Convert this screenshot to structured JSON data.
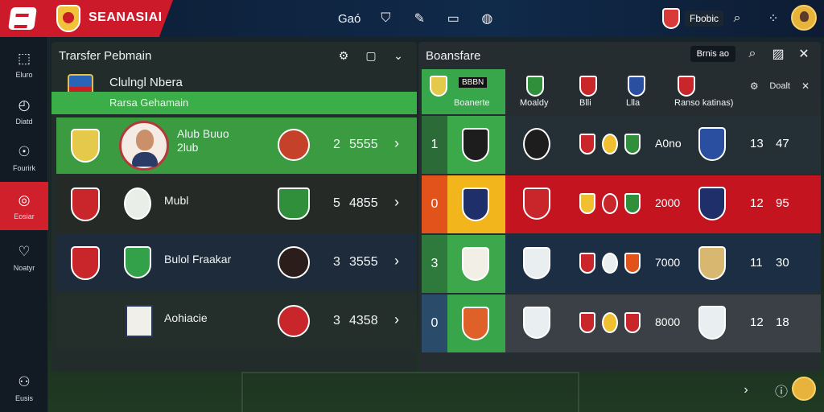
{
  "topbar": {
    "brand": "SEANASIAI",
    "tool_label": "Gaó",
    "user_name": "Fbobic"
  },
  "nav": [
    {
      "label": "Eluro",
      "icon": "transfer-icon"
    },
    {
      "label": "Diatd",
      "icon": "clock-icon"
    },
    {
      "label": "Fourirk",
      "icon": "runner-icon"
    },
    {
      "label": "Eosiar",
      "icon": "target-icon"
    },
    {
      "label": "Noatyr",
      "icon": "heart-icon"
    },
    {
      "label": "Eusis",
      "icon": "trophy-icon"
    }
  ],
  "left_panel": {
    "title": "Trarsfer Pebmain",
    "club_name": "Clulngl Nbera",
    "club_sub": "Rarsa Gehamain",
    "rows": [
      {
        "name_line1": "Alub Buuo",
        "name_line2": "2lub",
        "n1": "2",
        "n2": "5555",
        "bg": "#3a9b41"
      },
      {
        "name": "Mubl",
        "n1": "5",
        "n2": "4855",
        "bg": "#262a27"
      },
      {
        "name": "Bulol Fraakar",
        "n1": "3",
        "n2": "3555",
        "bg": "#1d2b3a"
      },
      {
        "name": "Aohiacie",
        "n1": "3",
        "n2": "4358",
        "bg": "#242e2a"
      }
    ]
  },
  "right_panel": {
    "title": "Boansfare",
    "pill": "Brnis ao",
    "first_col_tag": "BBBN",
    "col_labels": [
      "Boanerte",
      "Moaldy",
      "Blli",
      "Llla",
      "Ranso katinas)"
    ],
    "right_label": "Doalt",
    "rows": [
      {
        "rank": "1",
        "value": "A0no",
        "a": "13",
        "b": "47",
        "rank_bg": "#2a6b38",
        "mid_bg": "#3ba84a",
        "bg": "#253036"
      },
      {
        "rank": "0",
        "value": "2000",
        "a": "12",
        "b": "95",
        "rank_bg": "#e2531c",
        "mid_bg": "#f2b51c",
        "bg": "#c3141f"
      },
      {
        "rank": "3",
        "value": "7000",
        "a": "11",
        "b": "30",
        "rank_bg": "#2e7a3c",
        "mid_bg": "#3ca84b",
        "bg": "#1c2e44"
      },
      {
        "rank": "0",
        "value": "8000",
        "a": "12",
        "b": "18",
        "rank_bg": "#2a4c6a",
        "mid_bg": "#38a54a",
        "bg": "#3a4046"
      }
    ]
  }
}
